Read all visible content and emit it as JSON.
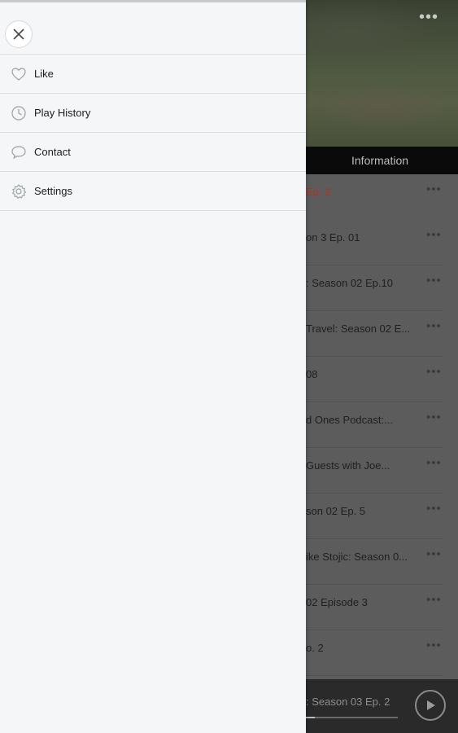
{
  "background": {
    "hero_menu_glyph": "•••",
    "tab_label": "Information",
    "episodes": [
      {
        "title": "Ep. 2",
        "active": true
      },
      {
        "title": "on 3 Ep. 01"
      },
      {
        "title": ": Season 02 Ep.10"
      },
      {
        "title": "Travel: Season 02 E..."
      },
      {
        "title": "08"
      },
      {
        "title": "d Ones Podcast:..."
      },
      {
        "title": "Guests with Joe..."
      },
      {
        "title": "son 02 Ep. 5"
      },
      {
        "title": "ike Stojic: Season 0..."
      },
      {
        "title": "02 Episode 3"
      },
      {
        "title": "o. 2"
      }
    ],
    "more_glyph": "•••",
    "player": {
      "now_playing": ": Season 03 Ep. 2",
      "progress": 0.1
    }
  },
  "drawer": {
    "items": [
      {
        "label": "Like",
        "icon": "heart-icon"
      },
      {
        "label": "Play History",
        "icon": "clock-icon"
      },
      {
        "label": "Contact",
        "icon": "chat-bubble-icon"
      },
      {
        "label": "Settings",
        "icon": "gear-icon"
      }
    ]
  },
  "colors": {
    "active_episode": "#b5301e",
    "drawer_bg": "#f4f6f7"
  }
}
